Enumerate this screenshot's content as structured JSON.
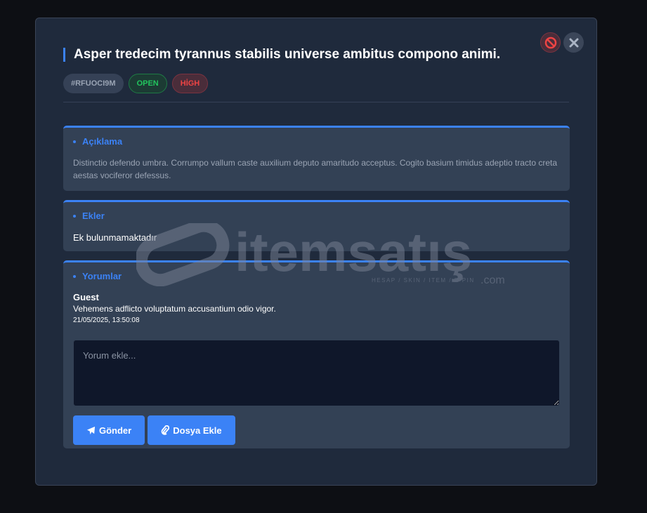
{
  "ticket": {
    "title": "Asper tredecim tyrannus stabilis universe ambitus compono animi.",
    "id": "#RFUOCI9M",
    "status": "OPEN",
    "priority": "HİGH"
  },
  "description": {
    "heading": "Açıklama",
    "text": "Distinctio defendo umbra. Corrumpo vallum caste auxilium deputo amaritudo acceptus. Cogito basium timidus adeptio tracto creta aestas vociferor defessus."
  },
  "attachments": {
    "heading": "Ekler",
    "empty_text": "Ek bulunmamaktadır"
  },
  "comments": {
    "heading": "Yorumlar",
    "items": [
      {
        "author": "Guest",
        "text": "Vehemens adflicto voluptatum accusantium odio vigor.",
        "time": "21/05/2025, 13:50:08"
      }
    ],
    "input_placeholder": "Yorum ekle...",
    "send_label": "Gönder",
    "attach_label": "Dosya Ekle"
  },
  "watermark": {
    "brand": "itemsatış",
    "tagline": "HESAP / SKIN / ITEM / E-PIN",
    "suffix": ".com"
  }
}
